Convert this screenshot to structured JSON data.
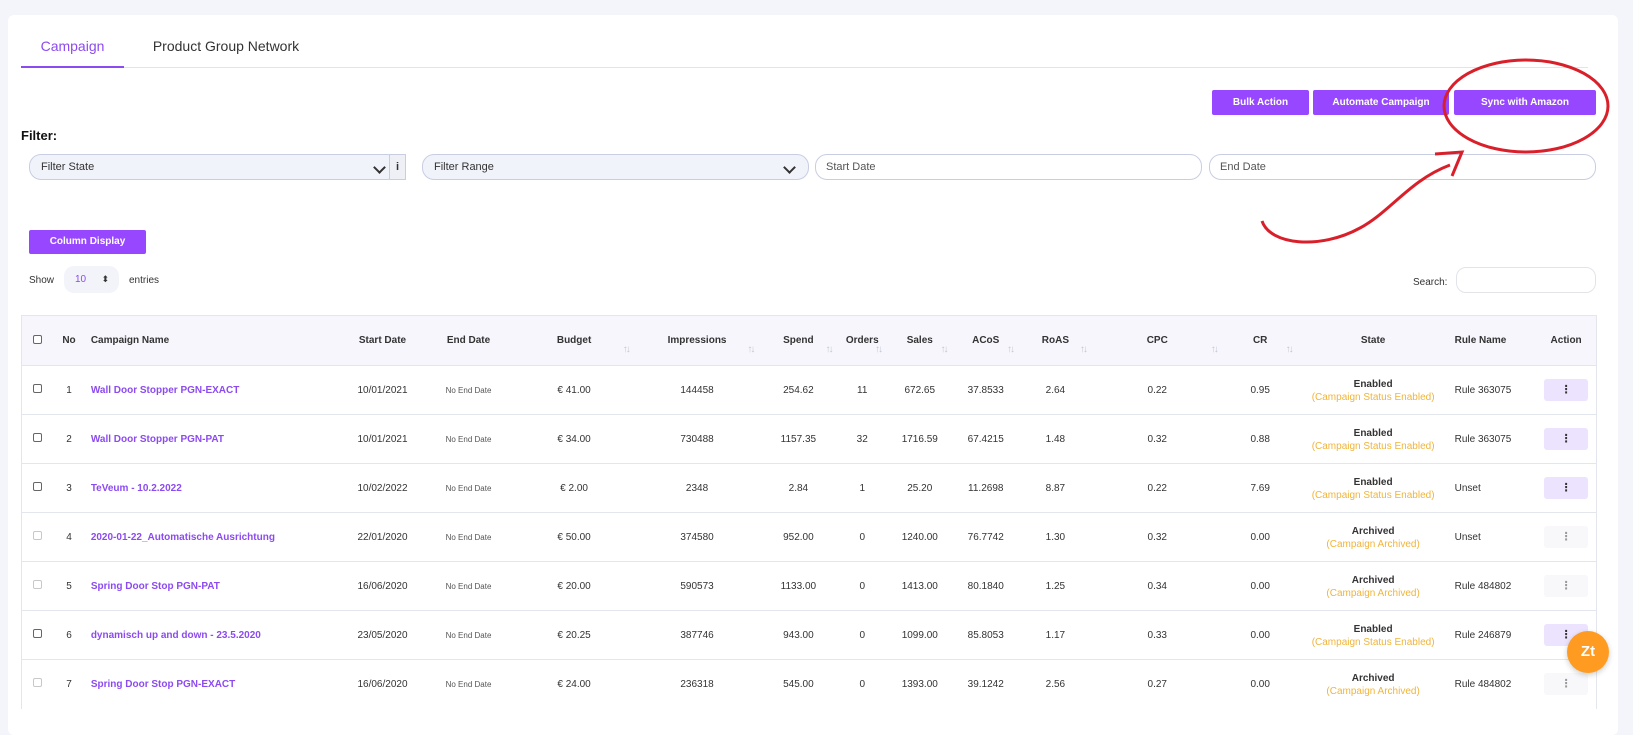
{
  "tabs": [
    {
      "label": "Campaign",
      "active": true
    },
    {
      "label": "Product Group Network",
      "active": false
    }
  ],
  "actions": {
    "bulk_action": "Bulk Action",
    "automate_campaign": "Automate Campaign",
    "sync_amazon": "Sync with Amazon"
  },
  "filter": {
    "label": "Filter:",
    "state_placeholder": "Filter State",
    "range_placeholder": "Filter Range",
    "info": "i",
    "start_date_placeholder": "Start Date",
    "end_date_placeholder": "End Date"
  },
  "column_display": "Column Display",
  "entries": {
    "show": "Show",
    "value": "10",
    "suffix": "entries"
  },
  "search": {
    "label": "Search:",
    "value": ""
  },
  "table": {
    "headers": [
      "No",
      "Campaign Name",
      "Start Date",
      "End Date",
      "Budget",
      "Impressions",
      "Spend",
      "Orders",
      "Sales",
      "ACoS",
      "RoAS",
      "CPC",
      "CR",
      "State",
      "Rule Name",
      "Action"
    ],
    "rows": [
      {
        "no": "1",
        "name": "Wall Door Stopper PGN-EXACT",
        "start": "10/01/2021",
        "end": "No End Date",
        "budget": "€ 41.00",
        "impressions": "144458",
        "spend": "254.62",
        "orders": "11",
        "sales": "672.65",
        "acos": "37.8533",
        "roas": "2.64",
        "cpc": "0.22",
        "cr": "0.95",
        "state": "Enabled",
        "state_sub": "(Campaign Status Enabled)",
        "rule": "Rule 363075",
        "action": "⋮",
        "enabled": true
      },
      {
        "no": "2",
        "name": "Wall Door Stopper PGN-PAT",
        "start": "10/01/2021",
        "end": "No End Date",
        "budget": "€ 34.00",
        "impressions": "730488",
        "spend": "1157.35",
        "orders": "32",
        "sales": "1716.59",
        "acos": "67.4215",
        "roas": "1.48",
        "cpc": "0.32",
        "cr": "0.88",
        "state": "Enabled",
        "state_sub": "(Campaign Status Enabled)",
        "rule": "Rule 363075",
        "action": "⋮",
        "enabled": true
      },
      {
        "no": "3",
        "name": "TeVeum - 10.2.2022",
        "start": "10/02/2022",
        "end": "No End Date",
        "budget": "€ 2.00",
        "impressions": "2348",
        "spend": "2.84",
        "orders": "1",
        "sales": "25.20",
        "acos": "11.2698",
        "roas": "8.87",
        "cpc": "0.22",
        "cr": "7.69",
        "state": "Enabled",
        "state_sub": "(Campaign Status Enabled)",
        "rule": "Unset",
        "action": "⋮",
        "enabled": true
      },
      {
        "no": "4",
        "name": "2020-01-22_Automatische Ausrichtung",
        "start": "22/01/2020",
        "end": "No End Date",
        "budget": "€ 50.00",
        "impressions": "374580",
        "spend": "952.00",
        "orders": "0",
        "sales": "1240.00",
        "acos": "76.7742",
        "roas": "1.30",
        "cpc": "0.32",
        "cr": "0.00",
        "state": "Archived",
        "state_sub": "(Campaign Archived)",
        "rule": "Unset",
        "action": "⋮",
        "enabled": false
      },
      {
        "no": "5",
        "name": "Spring Door Stop PGN-PAT",
        "start": "16/06/2020",
        "end": "No End Date",
        "budget": "€ 20.00",
        "impressions": "590573",
        "spend": "1133.00",
        "orders": "0",
        "sales": "1413.00",
        "acos": "80.1840",
        "roas": "1.25",
        "cpc": "0.34",
        "cr": "0.00",
        "state": "Archived",
        "state_sub": "(Campaign Archived)",
        "rule": "Rule 484802",
        "action": "⋮",
        "enabled": false
      },
      {
        "no": "6",
        "name": "dynamisch up and down - 23.5.2020",
        "start": "23/05/2020",
        "end": "No End Date",
        "budget": "€ 20.25",
        "impressions": "387746",
        "spend": "943.00",
        "orders": "0",
        "sales": "1099.00",
        "acos": "85.8053",
        "roas": "1.17",
        "cpc": "0.33",
        "cr": "0.00",
        "state": "Enabled",
        "state_sub": "(Campaign Status Enabled)",
        "rule": "Rule 246879",
        "action": "⋮",
        "enabled": true
      },
      {
        "no": "7",
        "name": "Spring Door Stop PGN-EXACT",
        "start": "16/06/2020",
        "end": "No End Date",
        "budget": "€ 24.00",
        "impressions": "236318",
        "spend": "545.00",
        "orders": "0",
        "sales": "1393.00",
        "acos": "39.1242",
        "roas": "2.56",
        "cpc": "0.27",
        "cr": "0.00",
        "state": "Archived",
        "state_sub": "(Campaign Archived)",
        "rule": "Rule 484802",
        "action": "⋮",
        "enabled": false
      }
    ]
  },
  "help_widget": "Zt",
  "colors": {
    "accent": "#9747ff",
    "state_sub": "#f0b43a",
    "annotation": "#d9202a",
    "widget": "#ff9b21"
  }
}
